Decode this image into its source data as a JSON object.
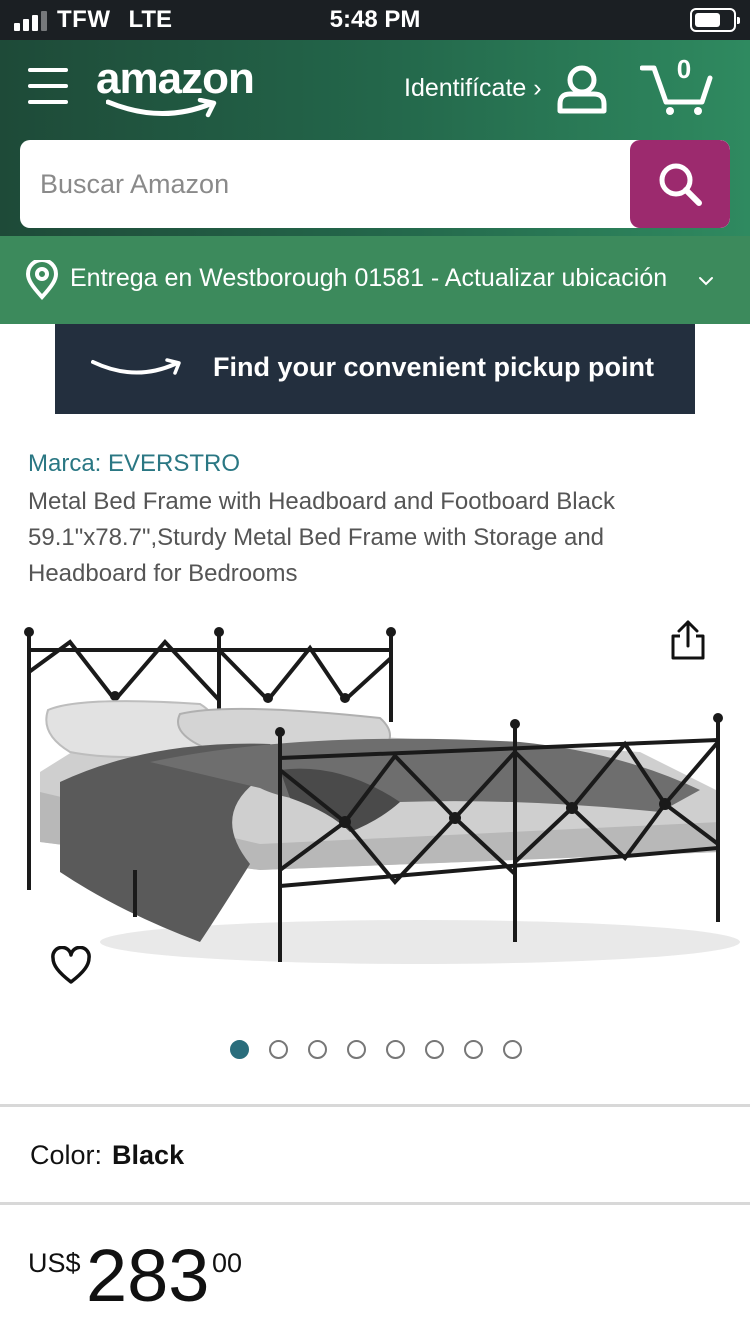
{
  "status_bar": {
    "carrier": "TFW",
    "network": "LTE",
    "time": "5:48 PM",
    "battery_level": 0.7
  },
  "header": {
    "logo_text": "amazon",
    "signin_label": "Identifícate ›",
    "cart_count": "0",
    "search": {
      "placeholder": "Buscar Amazon"
    },
    "colors": {
      "header": "#23664a",
      "search_button": "#9c2a6e"
    }
  },
  "delivery": {
    "text": "Entrega en Westborough 01581 - Actualizar ubicación"
  },
  "pickup_banner": {
    "text": "Find your convenient pickup point"
  },
  "product": {
    "brand": "Marca: EVERSTRO",
    "title": "Metal Bed Frame with Headboard and Footboard Black 59.1\"x78.7\",Sturdy Metal Bed Frame with Storage and Headboard for Bedrooms",
    "image_count": 8,
    "active_image": 1,
    "color_label": "Color:",
    "color_value": "Black",
    "price": {
      "currency": "US$",
      "whole": "283",
      "fraction": "00"
    }
  },
  "icons": [
    "menu-icon",
    "user-icon",
    "cart-icon",
    "search-icon",
    "location-pin-icon",
    "chevron-down-icon",
    "share-icon",
    "heart-icon"
  ]
}
